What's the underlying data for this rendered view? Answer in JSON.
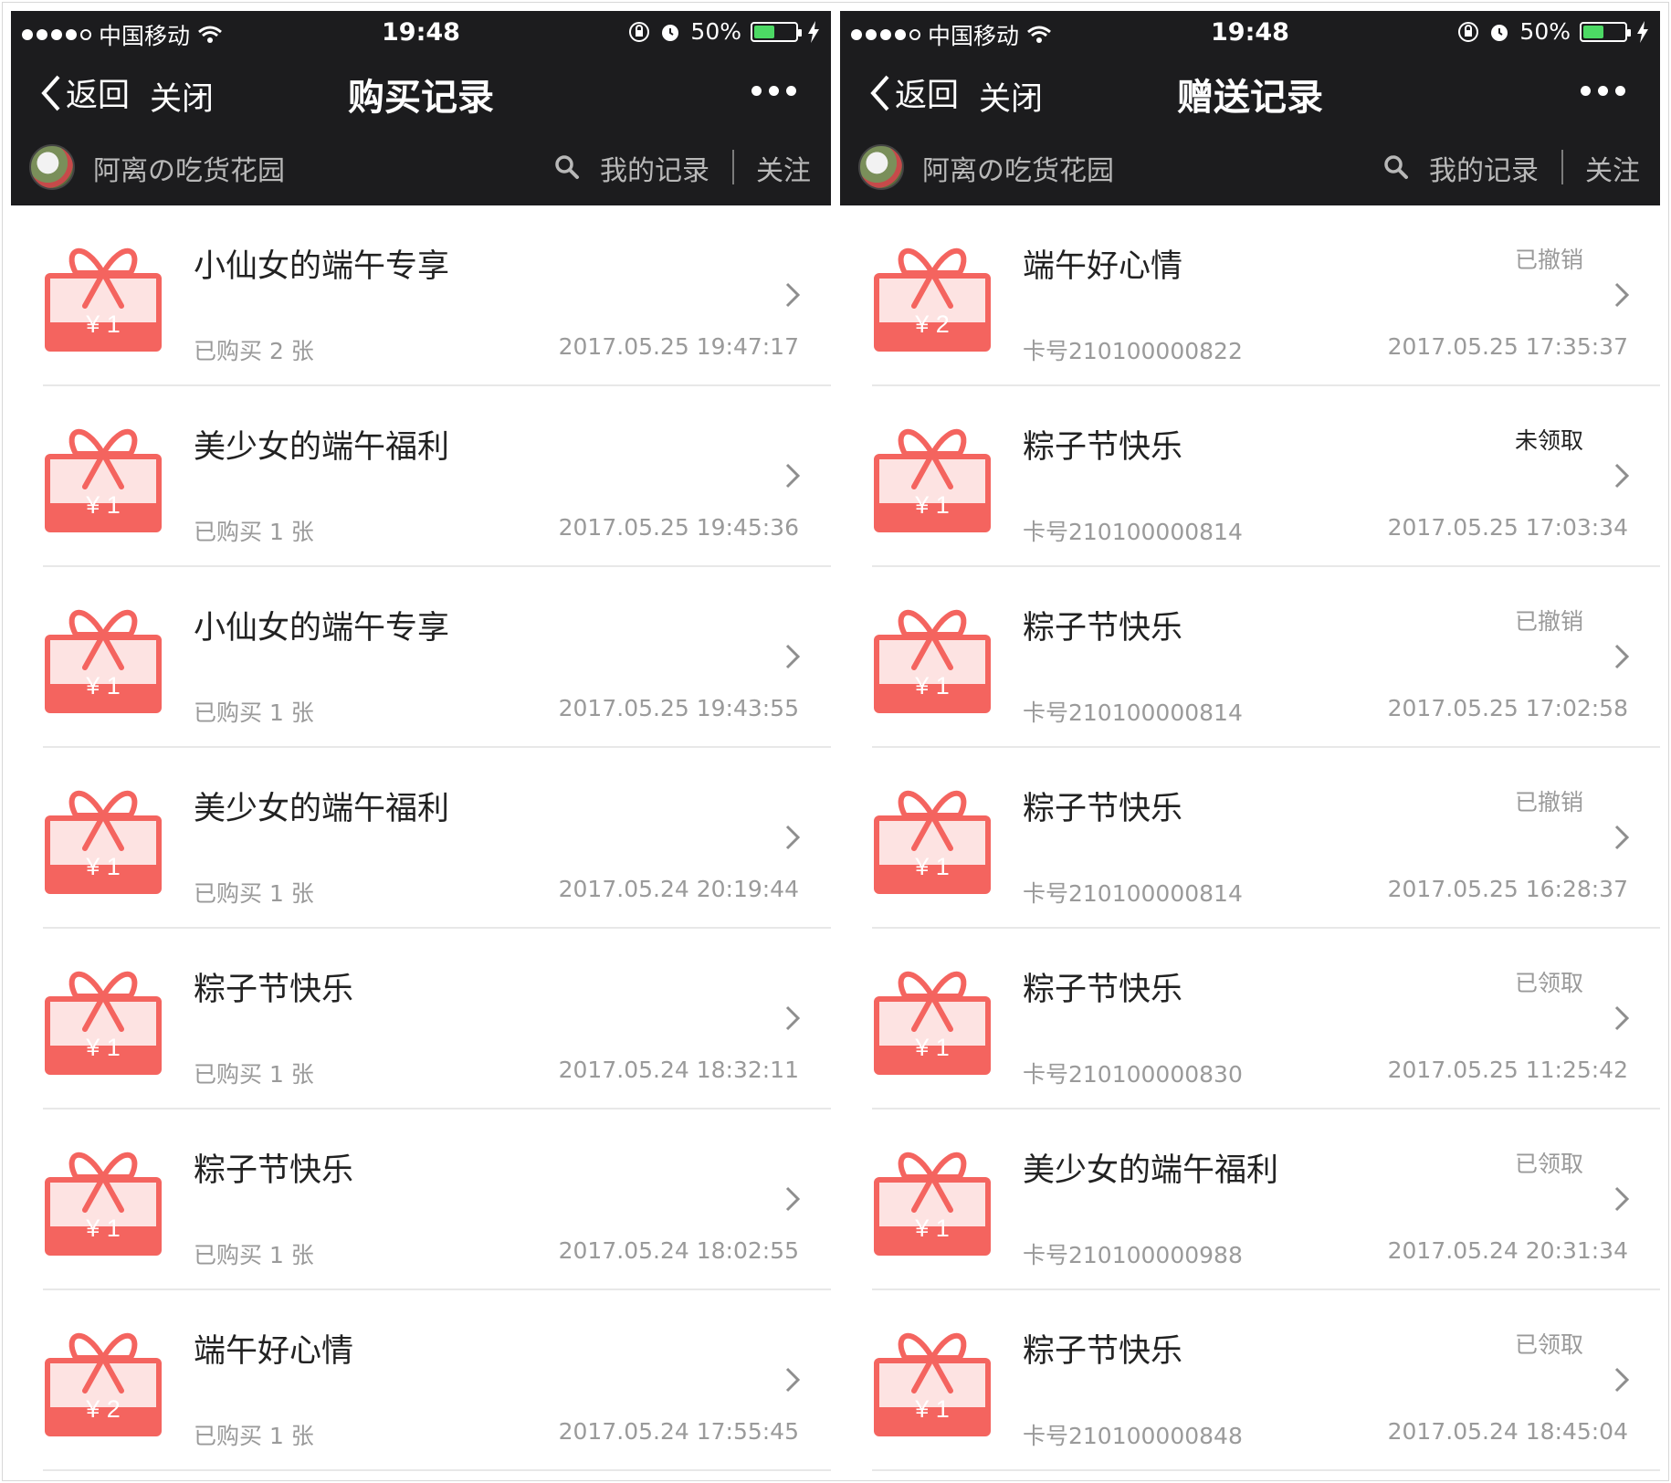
{
  "status_bar": {
    "carrier": "中国移动",
    "time": "19:48",
    "battery": "50%",
    "battery_level": 0.5
  },
  "left_panel": {
    "nav": {
      "back_label": "返回",
      "close_label": "关闭",
      "title": "购买记录"
    },
    "subbar": {
      "shop_name": "阿离の吃货花园",
      "my_records": "我的记录",
      "follow": "关注"
    },
    "items": [
      {
        "price": "¥ 1",
        "title": "小仙女的端午专享",
        "sub": "已购买 2 张",
        "time": "2017.05.25 19:47:17"
      },
      {
        "price": "¥ 1",
        "title": "美少女的端午福利",
        "sub": "已购买 1 张",
        "time": "2017.05.25 19:45:36"
      },
      {
        "price": "¥ 1",
        "title": "小仙女的端午专享",
        "sub": "已购买 1 张",
        "time": "2017.05.25 19:43:55"
      },
      {
        "price": "¥ 1",
        "title": "美少女的端午福利",
        "sub": "已购买 1 张",
        "time": "2017.05.24 20:19:44"
      },
      {
        "price": "¥ 1",
        "title": "粽子节快乐",
        "sub": "已购买 1 张",
        "time": "2017.05.24 18:32:11"
      },
      {
        "price": "¥ 1",
        "title": "粽子节快乐",
        "sub": "已购买 1 张",
        "time": "2017.05.24 18:02:55"
      },
      {
        "price": "¥ 2",
        "title": "端午好心情",
        "sub": "已购买 1 张",
        "time": "2017.05.24 17:55:45"
      }
    ]
  },
  "right_panel": {
    "nav": {
      "back_label": "返回",
      "close_label": "关闭",
      "title": "赠送记录"
    },
    "subbar": {
      "shop_name": "阿离の吃货花园",
      "my_records": "我的记录",
      "follow": "关注"
    },
    "items": [
      {
        "price": "¥ 2",
        "title": "端午好心情",
        "status": "已撤销",
        "sub": "卡号210100000822",
        "time": "2017.05.25 17:35:37"
      },
      {
        "price": "¥ 1",
        "title": "粽子节快乐",
        "status": "未领取",
        "sub": "卡号210100000814",
        "time": "2017.05.25 17:03:34"
      },
      {
        "price": "¥ 1",
        "title": "粽子节快乐",
        "status": "已撤销",
        "sub": "卡号210100000814",
        "time": "2017.05.25 17:02:58"
      },
      {
        "price": "¥ 1",
        "title": "粽子节快乐",
        "status": "已撤销",
        "sub": "卡号210100000814",
        "time": "2017.05.25 16:28:37"
      },
      {
        "price": "¥ 1",
        "title": "粽子节快乐",
        "status": "已领取",
        "sub": "卡号210100000830",
        "time": "2017.05.25 11:25:42"
      },
      {
        "price": "¥ 1",
        "title": "美少女的端午福利",
        "status": "已领取",
        "sub": "卡号210100000988",
        "time": "2017.05.24 20:31:34"
      },
      {
        "price": "¥ 1",
        "title": "粽子节快乐",
        "status": "已领取",
        "sub": "卡号210100000848",
        "time": "2017.05.24 18:45:04"
      }
    ]
  },
  "colors": {
    "topbar": "#1c1c1e",
    "gift": "#f4645f",
    "gift_band": "#fde3e2",
    "muted_text": "#9a9a9a",
    "battery_fill": "#4cd964"
  }
}
